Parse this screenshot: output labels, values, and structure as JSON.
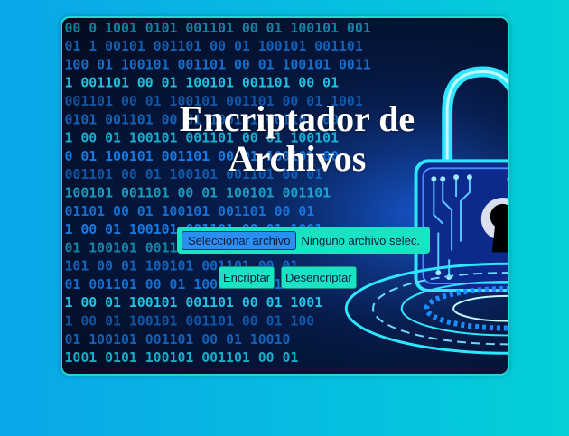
{
  "page": {
    "title": "Encriptador de Archivos"
  },
  "upload": {
    "button_label": "Seleccionar archivo",
    "status_text": "Ninguno archivo selec."
  },
  "actions": {
    "encrypt_label": "Encriptar",
    "decrypt_label": "Desencriptar"
  },
  "background": {
    "binary_rows": [
      "00 0 1001  0101 001101 00 01 100101 001",
      "01 1 00101 001101 00 01 100101 001101",
      "100 01 100101 001101 00 01 100101 0011",
      "1 001101 00 01 100101 001101 00 01",
      " 001101 00 01 100101 001101 00 01 1001",
      "0101 001101 00 01 100101 001101 00",
      "1 00 01 100101 001101 00 01 100101",
      "0 01 100101 001101 00 01 100101 00",
      "001101 00 01 100101 001101 00 01",
      "100101 001101 00 01 100101 001101",
      "01101 00 01 100101 001101 00 01",
      "1 00 01 100101 001101 00 01 1001",
      " 01 100101 001101 00 01 100101 00",
      "101 00 01 100101 001101 00 01",
      "01 001101 00 01 100101 001101 00",
      "1 00 01 100101 001101 00 01 1001",
      " 1 00 01 100101 001101 00 01 100",
      "01  100101 001101 00 01  10010",
      "1001  0101  100101 001101 00 01"
    ],
    "accent_colors": [
      "#22e0ff",
      "#1a8cff",
      "#ffffff"
    ]
  }
}
